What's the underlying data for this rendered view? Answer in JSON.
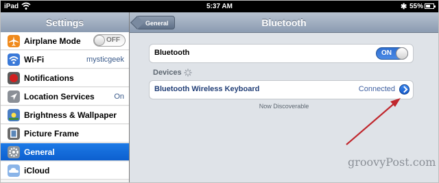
{
  "status_bar": {
    "carrier": "iPad",
    "time": "5:37 AM",
    "battery": "55%",
    "battery_level": 0.55,
    "wifi_icon": "wifi-icon",
    "bluetooth_icon": "bluetooth-icon"
  },
  "sidebar": {
    "title": "Settings",
    "items": [
      {
        "label": "Airplane Mode",
        "icon": "airplane-icon",
        "toggle": "OFF",
        "color": "#f08a1c"
      },
      {
        "label": "Wi-Fi",
        "icon": "wifi-icon",
        "value": "mysticgeek",
        "color": "#3a79d8"
      },
      {
        "label": "Notifications",
        "icon": "notifications-icon",
        "color": "#d02020"
      },
      {
        "label": "Location Services",
        "icon": "location-icon",
        "value": "On",
        "color": "#8a8f96"
      },
      {
        "label": "Brightness & Wallpaper",
        "icon": "brightness-icon",
        "color": "#4a7ec4"
      },
      {
        "label": "Picture Frame",
        "icon": "picture-frame-icon",
        "color": "#6b6b6b"
      },
      {
        "label": "General",
        "icon": "gear-icon",
        "selected": true,
        "color": "#8d949c"
      },
      {
        "label": "iCloud",
        "icon": "icloud-icon",
        "color": "#8ab4e8"
      }
    ]
  },
  "detail": {
    "title": "Bluetooth",
    "back_label": "General",
    "bluetooth_row": {
      "label": "Bluetooth",
      "toggle": "ON"
    },
    "devices_header": "Devices",
    "device": {
      "name": "Bluetooth Wireless Keyboard",
      "status": "Connected"
    },
    "discoverable_text": "Now Discoverable"
  },
  "watermark": "groovyPost.com",
  "colors": {
    "accent": "#0c5fcf",
    "arrow": "#c0272d"
  }
}
